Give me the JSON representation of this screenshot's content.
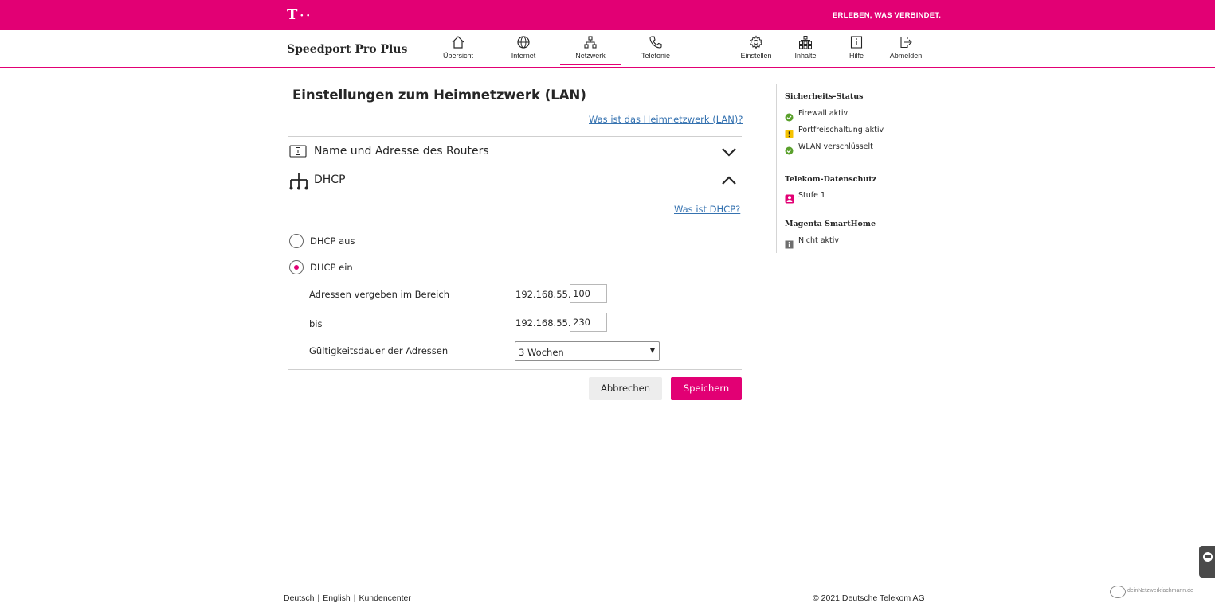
{
  "brand": {
    "logo_letter": "T",
    "logo_dots": "··",
    "slogan": "ERLEBEN, WAS VERBINDET.",
    "router_name": "Speedport Pro Plus"
  },
  "nav": {
    "main": [
      {
        "label": "Übersicht",
        "icon": "home-icon"
      },
      {
        "label": "Internet",
        "icon": "globe-icon"
      },
      {
        "label": "Netzwerk",
        "icon": "network-icon",
        "active": true
      },
      {
        "label": "Telefonie",
        "icon": "phone-icon"
      }
    ],
    "right": [
      {
        "label": "Einstellen",
        "icon": "gear-icon"
      },
      {
        "label": "Inhalte",
        "icon": "sitemap-icon"
      },
      {
        "label": "Hilfe",
        "icon": "info-icon"
      },
      {
        "label": "Abmelden",
        "icon": "logout-icon"
      }
    ]
  },
  "main": {
    "title": "Einstellungen zum Heimnetzwerk (LAN)",
    "help_lan": "Was ist das Heimnetzwerk (LAN)?",
    "sections": [
      {
        "label": "Name und Adresse des Routers",
        "icon": "router-icon",
        "expanded": false
      },
      {
        "label": "DHCP",
        "icon": "network-tree-icon",
        "expanded": true
      }
    ],
    "help_dhcp": "Was ist DHCP?",
    "dhcp": {
      "option_off": "DHCP aus",
      "option_on": "DHCP ein",
      "selected": "on",
      "range_label": "Adressen vergeben im Bereich",
      "range_prefix": "192.168.55.",
      "range_start": "100",
      "to_label": "bis",
      "to_prefix": "192.168.55.",
      "range_end": "230",
      "lease_label": "Gültigkeitsdauer der Adressen",
      "lease_value": "3 Wochen"
    },
    "buttons": {
      "cancel": "Abbrechen",
      "save": "Speichern"
    }
  },
  "sidebar": {
    "security_title": "Sicherheits-Status",
    "security_items": [
      {
        "label": "Firewall aktiv",
        "status": "ok"
      },
      {
        "label": "Portfreischaltung aktiv",
        "status": "warning"
      },
      {
        "label": "WLAN verschlüsselt",
        "status": "ok"
      }
    ],
    "privacy_title": "Telekom-Datenschutz",
    "privacy_value": "Stufe 1",
    "smarthome_title": "Magenta SmartHome",
    "smarthome_value": "Nicht aktiv"
  },
  "footer": {
    "lang_de": "Deutsch",
    "lang_en": "English",
    "kundencenter": "Kundencenter",
    "separator": "|",
    "copyright": "© 2021 Deutsche Telekom AG"
  },
  "watermark": {
    "text": "deinNetzwerkfachmann.de"
  },
  "colors": {
    "magenta": "#e20074",
    "link": "#3572b0",
    "ok": "#5aa02c",
    "warning": "#f5c200"
  }
}
